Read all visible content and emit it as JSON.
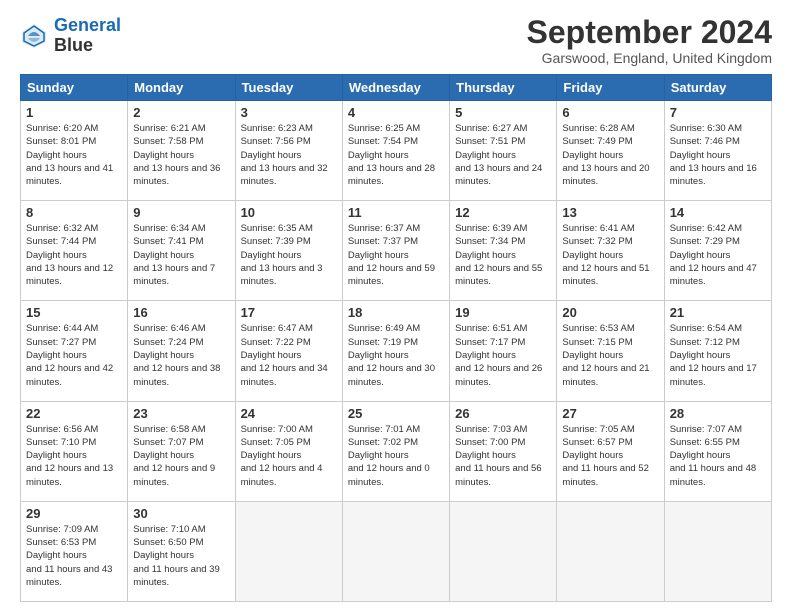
{
  "header": {
    "logo_line1": "General",
    "logo_line2": "Blue",
    "month_year": "September 2024",
    "location": "Garswood, England, United Kingdom"
  },
  "days_of_week": [
    "Sunday",
    "Monday",
    "Tuesday",
    "Wednesday",
    "Thursday",
    "Friday",
    "Saturday"
  ],
  "weeks": [
    [
      {
        "day": "1",
        "sunrise": "6:20 AM",
        "sunset": "8:01 PM",
        "daylight": "13 hours and 41 minutes."
      },
      {
        "day": "2",
        "sunrise": "6:21 AM",
        "sunset": "7:58 PM",
        "daylight": "13 hours and 36 minutes."
      },
      {
        "day": "3",
        "sunrise": "6:23 AM",
        "sunset": "7:56 PM",
        "daylight": "13 hours and 32 minutes."
      },
      {
        "day": "4",
        "sunrise": "6:25 AM",
        "sunset": "7:54 PM",
        "daylight": "13 hours and 28 minutes."
      },
      {
        "day": "5",
        "sunrise": "6:27 AM",
        "sunset": "7:51 PM",
        "daylight": "13 hours and 24 minutes."
      },
      {
        "day": "6",
        "sunrise": "6:28 AM",
        "sunset": "7:49 PM",
        "daylight": "13 hours and 20 minutes."
      },
      {
        "day": "7",
        "sunrise": "6:30 AM",
        "sunset": "7:46 PM",
        "daylight": "13 hours and 16 minutes."
      }
    ],
    [
      {
        "day": "8",
        "sunrise": "6:32 AM",
        "sunset": "7:44 PM",
        "daylight": "13 hours and 12 minutes."
      },
      {
        "day": "9",
        "sunrise": "6:34 AM",
        "sunset": "7:41 PM",
        "daylight": "13 hours and 7 minutes."
      },
      {
        "day": "10",
        "sunrise": "6:35 AM",
        "sunset": "7:39 PM",
        "daylight": "13 hours and 3 minutes."
      },
      {
        "day": "11",
        "sunrise": "6:37 AM",
        "sunset": "7:37 PM",
        "daylight": "12 hours and 59 minutes."
      },
      {
        "day": "12",
        "sunrise": "6:39 AM",
        "sunset": "7:34 PM",
        "daylight": "12 hours and 55 minutes."
      },
      {
        "day": "13",
        "sunrise": "6:41 AM",
        "sunset": "7:32 PM",
        "daylight": "12 hours and 51 minutes."
      },
      {
        "day": "14",
        "sunrise": "6:42 AM",
        "sunset": "7:29 PM",
        "daylight": "12 hours and 47 minutes."
      }
    ],
    [
      {
        "day": "15",
        "sunrise": "6:44 AM",
        "sunset": "7:27 PM",
        "daylight": "12 hours and 42 minutes."
      },
      {
        "day": "16",
        "sunrise": "6:46 AM",
        "sunset": "7:24 PM",
        "daylight": "12 hours and 38 minutes."
      },
      {
        "day": "17",
        "sunrise": "6:47 AM",
        "sunset": "7:22 PM",
        "daylight": "12 hours and 34 minutes."
      },
      {
        "day": "18",
        "sunrise": "6:49 AM",
        "sunset": "7:19 PM",
        "daylight": "12 hours and 30 minutes."
      },
      {
        "day": "19",
        "sunrise": "6:51 AM",
        "sunset": "7:17 PM",
        "daylight": "12 hours and 26 minutes."
      },
      {
        "day": "20",
        "sunrise": "6:53 AM",
        "sunset": "7:15 PM",
        "daylight": "12 hours and 21 minutes."
      },
      {
        "day": "21",
        "sunrise": "6:54 AM",
        "sunset": "7:12 PM",
        "daylight": "12 hours and 17 minutes."
      }
    ],
    [
      {
        "day": "22",
        "sunrise": "6:56 AM",
        "sunset": "7:10 PM",
        "daylight": "12 hours and 13 minutes."
      },
      {
        "day": "23",
        "sunrise": "6:58 AM",
        "sunset": "7:07 PM",
        "daylight": "12 hours and 9 minutes."
      },
      {
        "day": "24",
        "sunrise": "7:00 AM",
        "sunset": "7:05 PM",
        "daylight": "12 hours and 4 minutes."
      },
      {
        "day": "25",
        "sunrise": "7:01 AM",
        "sunset": "7:02 PM",
        "daylight": "12 hours and 0 minutes."
      },
      {
        "day": "26",
        "sunrise": "7:03 AM",
        "sunset": "7:00 PM",
        "daylight": "11 hours and 56 minutes."
      },
      {
        "day": "27",
        "sunrise": "7:05 AM",
        "sunset": "6:57 PM",
        "daylight": "11 hours and 52 minutes."
      },
      {
        "day": "28",
        "sunrise": "7:07 AM",
        "sunset": "6:55 PM",
        "daylight": "11 hours and 48 minutes."
      }
    ],
    [
      {
        "day": "29",
        "sunrise": "7:09 AM",
        "sunset": "6:53 PM",
        "daylight": "11 hours and 43 minutes."
      },
      {
        "day": "30",
        "sunrise": "7:10 AM",
        "sunset": "6:50 PM",
        "daylight": "11 hours and 39 minutes."
      },
      null,
      null,
      null,
      null,
      null
    ]
  ]
}
